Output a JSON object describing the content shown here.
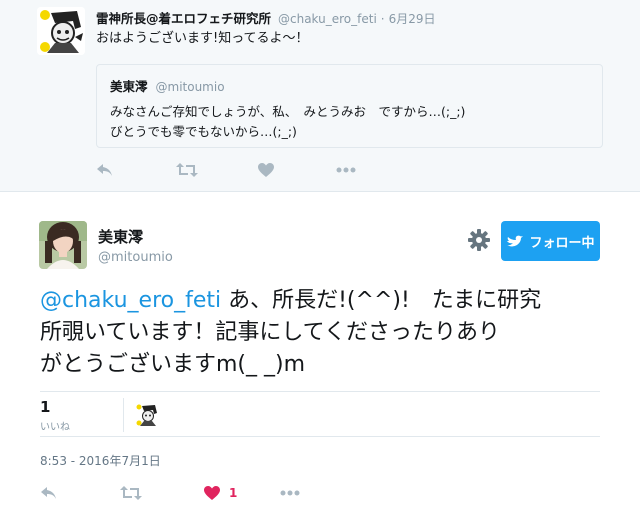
{
  "parent_tweet": {
    "author_name": "雷神所長@着エロフェチ研究所",
    "handle": "@chaku_ero_feti",
    "separator": "·",
    "date": "6月29日",
    "text": "おはようございます!知ってるよ～！",
    "quoted": {
      "author_name": "美東澪",
      "handle": "@mitoumio",
      "line1": "みなさんご存知でしょうが、私、　みとうみお　ですから…(;_;)",
      "line2": "びとうでも零でもないから…(;_;)"
    },
    "actions": [
      "reply-icon",
      "retweet-icon",
      "like-icon",
      "more-icon"
    ]
  },
  "main_tweet": {
    "author_name": "美東澪",
    "handle": "@mitoumio",
    "follow_label": "フォロー中",
    "text": {
      "mention": "@chaku_ero_feti",
      "line1_rest": " あ、所長だ!(^^)!　たまに研究",
      "line2": "所覗いています！記事にしてくださったりあり",
      "line3": "がとうございますm(_ _)m"
    },
    "likes": {
      "count": "1",
      "label": "いいね"
    },
    "timestamp": "8:53 - 2016年7月1日",
    "like_action_count": "1"
  },
  "colors": {
    "accent": "#1da1f2",
    "mention": "#1b95e0",
    "like": "#e0245e",
    "muted": "#8899a6",
    "parent_bg": "#f5f8fa"
  }
}
